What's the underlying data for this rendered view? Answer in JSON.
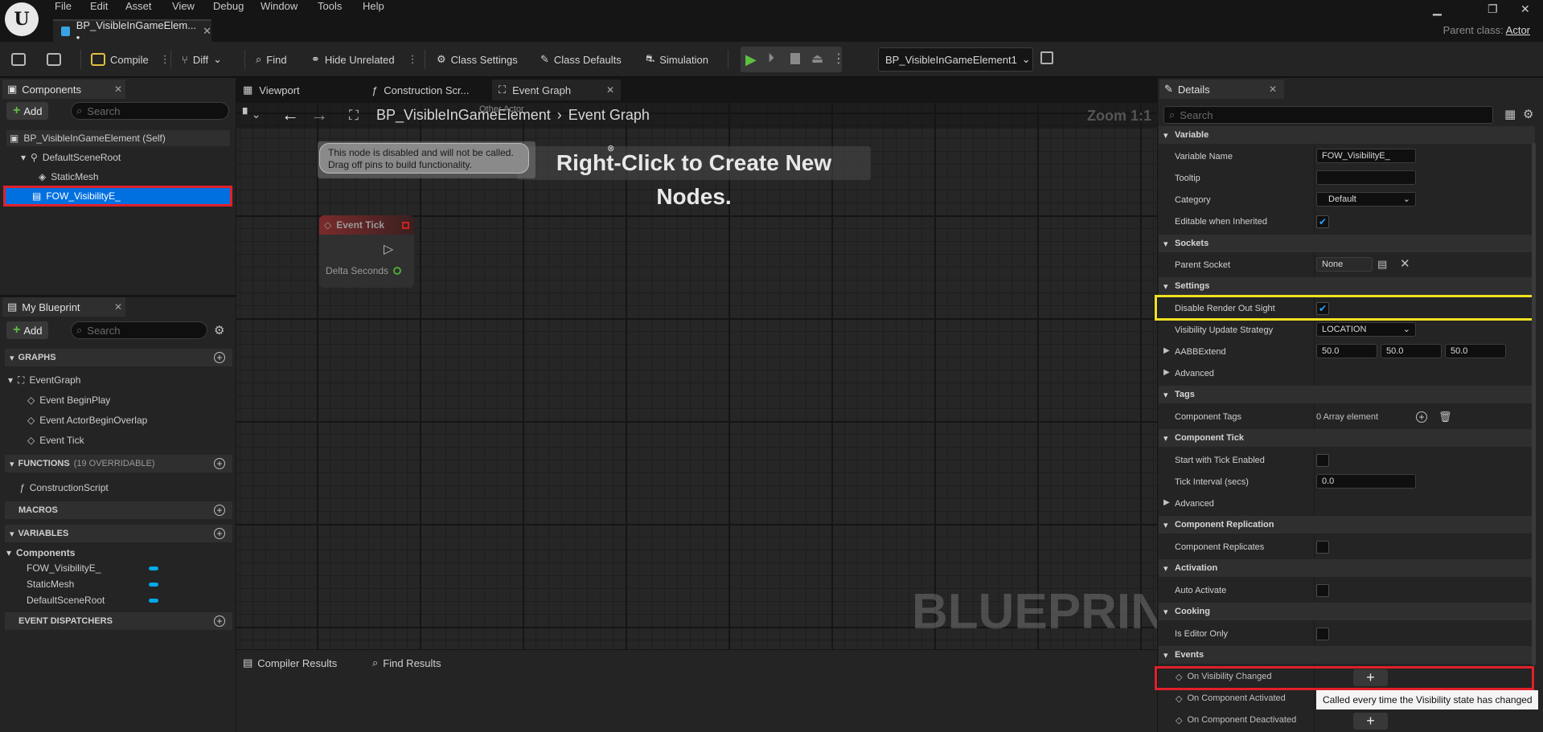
{
  "menu": [
    "File",
    "Edit",
    "Asset",
    "View",
    "Debug",
    "Window",
    "Tools",
    "Help"
  ],
  "doc_tab": {
    "title": "BP_VisibleInGameElem... •"
  },
  "parent_class": {
    "label": "Parent class:",
    "value": "Actor"
  },
  "toolbar": {
    "compile": "Compile",
    "diff": "Diff",
    "find": "Find",
    "hide_unrelated": "Hide Unrelated",
    "class_settings": "Class Settings",
    "class_defaults": "Class Defaults",
    "simulation": "Simulation",
    "debug_object": "BP_VisibleInGameElement1"
  },
  "components": {
    "title": "Components",
    "add": "Add",
    "search_placeholder": "Search",
    "items": [
      "BP_VisibleInGameElement (Self)",
      "DefaultSceneRoot",
      "StaticMesh",
      "FOW_VisibilityE_"
    ]
  },
  "my_blueprint": {
    "title": "My Blueprint",
    "add": "Add",
    "search_placeholder": "Search",
    "graphs_header": "GRAPHS",
    "event_graph": "EventGraph",
    "events": [
      "Event BeginPlay",
      "Event ActorBeginOverlap",
      "Event Tick"
    ],
    "functions_header": "FUNCTIONS",
    "functions_count": "(19 OVERRIDABLE)",
    "construction_script": "ConstructionScript",
    "macros_header": "MACROS",
    "variables_header": "VARIABLES",
    "components_group": "Components",
    "variables": [
      "FOW_VisibilityE_",
      "StaticMesh",
      "DefaultSceneRoot"
    ],
    "dispatchers_header": "EVENT DISPATCHERS"
  },
  "graph_tabs": [
    "Viewport",
    "Construction Scr...",
    "Event Graph"
  ],
  "graph": {
    "breadcrumb_root": "BP_VisibleInGameElement",
    "breadcrumb_leaf": "Event Graph",
    "zoom": "Zoom 1:1",
    "hint": "Right-Click to Create New Nodes.",
    "other_actor": "Other Actor",
    "disabled_note": "This node is disabled and will not be called.\nDrag off pins to build functionality.",
    "node_title": "Event Tick",
    "node_pin": "Delta Seconds",
    "watermark": "BLUEPRINT"
  },
  "bottom_tabs": [
    "Compiler Results",
    "Find Results"
  ],
  "details": {
    "title": "Details",
    "search_placeholder": "Search",
    "sections": {
      "variable": "Variable",
      "sockets": "Sockets",
      "settings": "Settings",
      "tags": "Tags",
      "component_tick": "Component Tick",
      "component_replication": "Component Replication",
      "activation": "Activation",
      "cooking": "Cooking",
      "events": "Events"
    },
    "variable_name_label": "Variable Name",
    "variable_name_value": "FOW_VisibilityE_",
    "tooltip_label": "Tooltip",
    "category_label": "Category",
    "category_value": "Default",
    "editable_label": "Editable when Inherited",
    "parent_socket_label": "Parent Socket",
    "parent_socket_value": "None",
    "disable_render_label": "Disable Render Out Sight",
    "visibility_strategy_label": "Visibility Update Strategy",
    "visibility_strategy_value": "LOCATION",
    "aabb_label": "AABBExtend",
    "aabb_values": [
      "50.0",
      "50.0",
      "50.0"
    ],
    "advanced": "Advanced",
    "component_tags_label": "Component Tags",
    "component_tags_value": "0 Array element",
    "start_tick_label": "Start with Tick Enabled",
    "tick_interval_label": "Tick Interval (secs)",
    "tick_interval_value": "0.0",
    "replicates_label": "Component Replicates",
    "auto_activate_label": "Auto Activate",
    "editor_only_label": "Is Editor Only",
    "events": [
      "On Visibility Changed",
      "On Component Activated",
      "On Component Deactivated"
    ],
    "tooltip_text": "Called every time the Visibility state has changed"
  }
}
